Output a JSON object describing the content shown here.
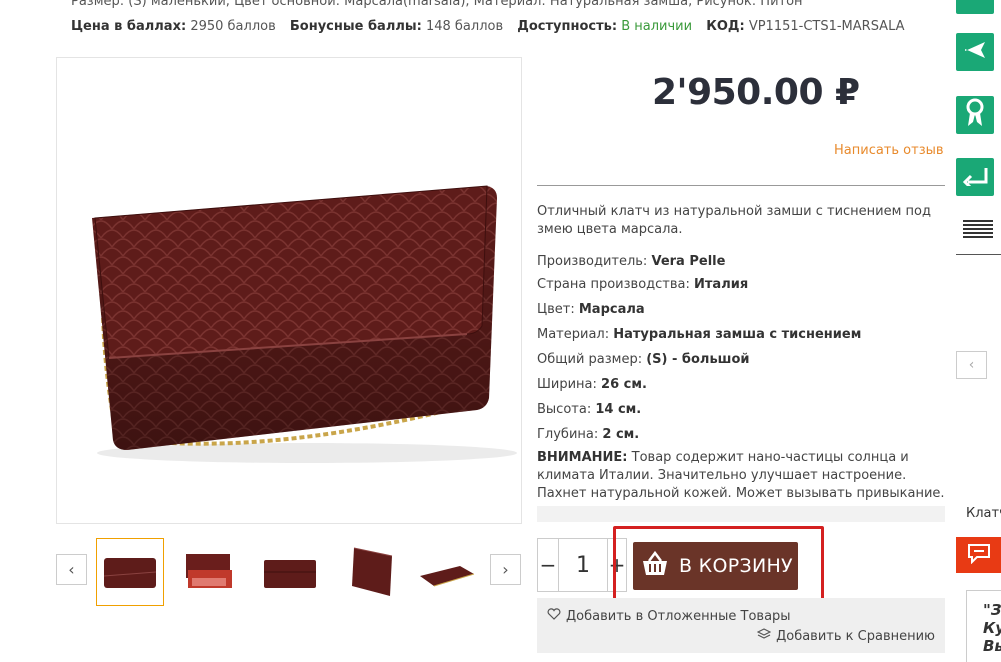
{
  "meta": {
    "line1": "Размер: (S) маленький, Цвет основной: Марсала(marsala), Материал: Натуральная замша, Рисунок: Питон",
    "price_points_label": "Цена в баллах:",
    "price_points_value": "2950 баллов",
    "bonus_label": "Бонусные баллы:",
    "bonus_value": "148 баллов",
    "availability_label": "Доступность:",
    "availability_value": "В наличии",
    "code_label": "КОД:",
    "code_value": "VP1151-CTS1-MARSALA"
  },
  "product": {
    "price": "2'950.00 ₽",
    "review_link": "Написать отзыв",
    "description": "Отличный клатч из натуральной замши с тиснением под змею цвета марсала.",
    "specs": [
      {
        "label": "Производитель:",
        "value": "Vera Pelle"
      },
      {
        "label": "Страна производства:",
        "value": "Италия"
      },
      {
        "label": "Цвет:",
        "value": "Марсала"
      },
      {
        "label": "Материал:",
        "value": "Натуральная замша с тиснением"
      },
      {
        "label": "Общий размер:",
        "value": "(S) - большой"
      },
      {
        "label": "Ширина:",
        "value": "26 см."
      },
      {
        "label": "Высота:",
        "value": "14 см."
      },
      {
        "label": "Глубина:",
        "value": "2 см."
      }
    ],
    "warning_label": "ВНИМАНИЕ:",
    "warning_text": "Товар содержит нано-частицы солнца и климата Италии. Значительно улучшает настроение. Пахнет натуральной кожей. Может вызывать привыкание."
  },
  "purchase": {
    "quantity": "1",
    "minus": "−",
    "plus": "+",
    "cart_label": "В КОРЗИНУ",
    "wishlist_label": "Добавить в Отложенные Товары",
    "compare_label": "Добавить к Сравнению"
  },
  "gallery": {
    "prev_icon": "chevron-left-icon",
    "next_icon": "chevron-right-icon",
    "thumb_count": 5,
    "active_index": 0
  },
  "sidebar": {
    "label": "Клатч",
    "quote_lines": [
      "\"З",
      "Ку",
      "Вы"
    ],
    "buttons": [
      "plane-icon",
      "award-icon",
      "return-icon"
    ]
  },
  "colors": {
    "accent_green": "#1aa876",
    "cart_brown": "#6a3428",
    "highlight_red": "#d42020",
    "link_orange": "#e88a2c",
    "stock_green": "#3a9a3a",
    "chat_orange": "#e83a14",
    "bag_color": "#5e1c1a"
  }
}
